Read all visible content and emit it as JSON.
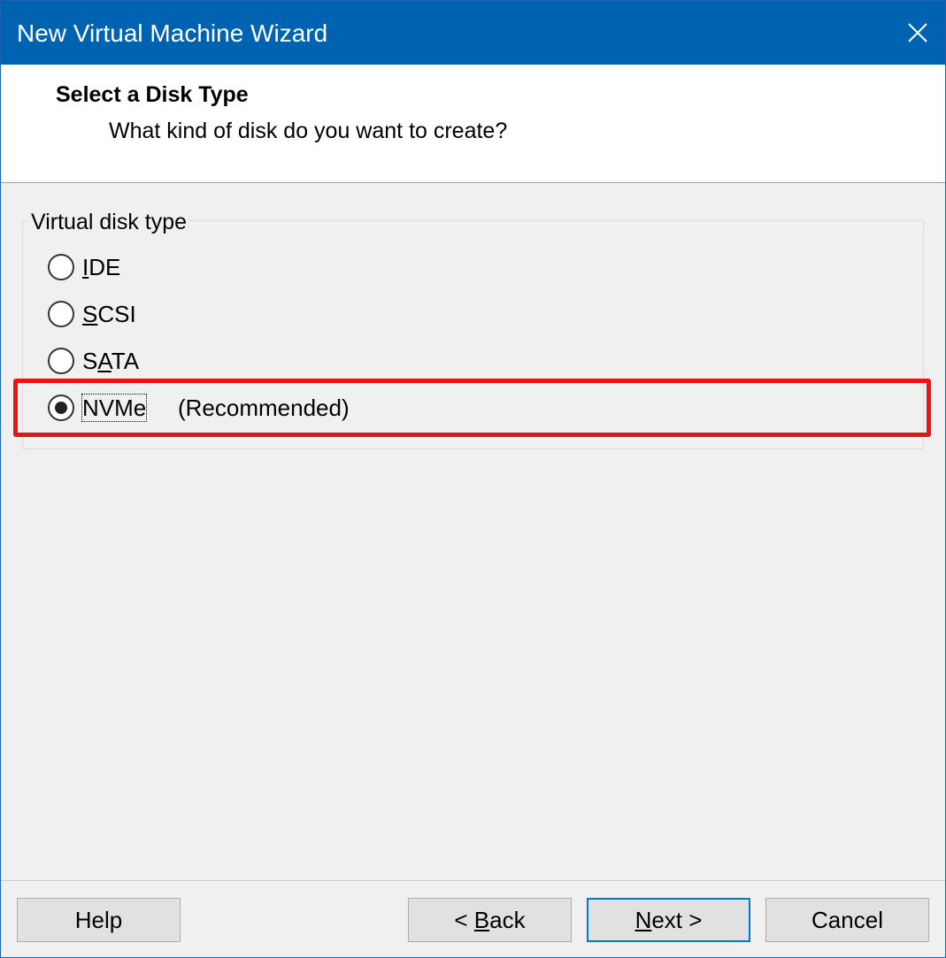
{
  "window": {
    "title": "New Virtual Machine Wizard"
  },
  "header": {
    "title": "Select a Disk Type",
    "subtitle": "What kind of disk do you want to create?"
  },
  "disk_type_group": {
    "label": "Virtual disk type",
    "options": [
      {
        "label": "IDE",
        "mnemonic": "I",
        "rest": "DE",
        "selected": false
      },
      {
        "label": "SCSI",
        "mnemonic": "S",
        "rest": "CSI",
        "selected": false
      },
      {
        "label": "SATA",
        "pre": "S",
        "mnemonic": "A",
        "rest": "TA",
        "selected": false
      },
      {
        "label": "NVMe",
        "mnemonic": "",
        "rest": "NVMe",
        "selected": true,
        "note": "(Recommended)"
      }
    ]
  },
  "buttons": {
    "help": {
      "pre": "Help",
      "mnemonic": "",
      "post": ""
    },
    "back": {
      "pre": "< ",
      "mnemonic": "B",
      "post": "ack"
    },
    "next": {
      "pre": "",
      "mnemonic": "N",
      "post": "ext >"
    },
    "cancel": {
      "pre": "Cancel",
      "mnemonic": "",
      "post": ""
    }
  },
  "colors": {
    "titlebar": "#0063b1",
    "highlight": "#ee1111",
    "default_button_border": "#0078d7"
  },
  "icons": {
    "close": "close-icon"
  }
}
